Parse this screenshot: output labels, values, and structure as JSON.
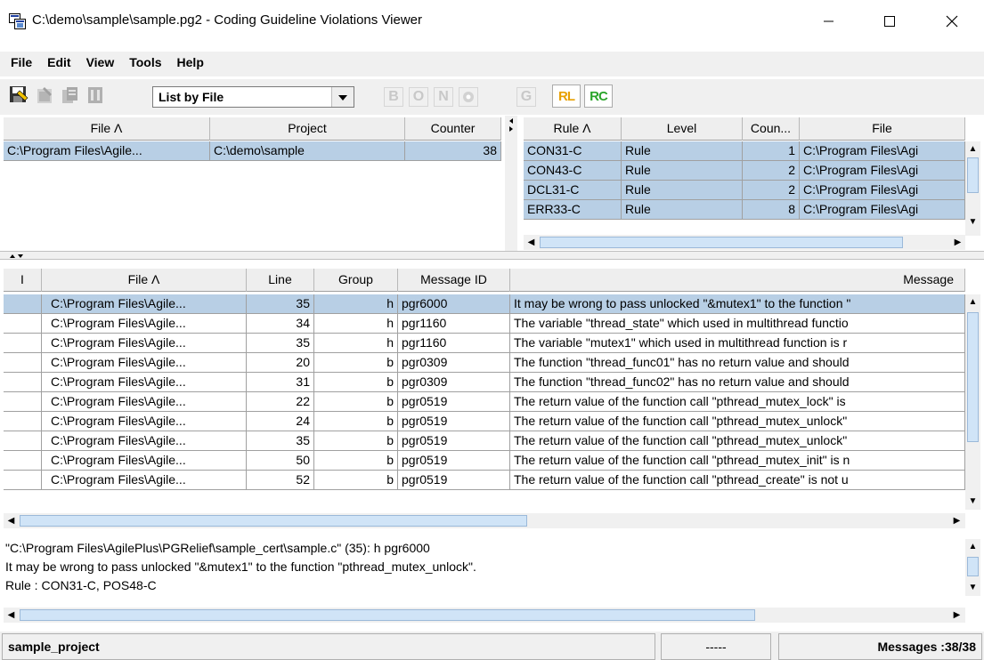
{
  "window": {
    "title": "C:\\demo\\sample\\sample.pg2 - Coding Guideline Violations Viewer",
    "minimize_icon": "minimize-icon",
    "maximize_icon": "maximize-icon",
    "close_icon": "close-icon"
  },
  "menu": [
    "File",
    "Edit",
    "View",
    "Tools",
    "Help"
  ],
  "toolbar": {
    "view_mode": "List by File",
    "letter_buttons": [
      "B",
      "O",
      "N",
      "G"
    ],
    "rl_label": "RL",
    "rc_label": "RC",
    "rl_color": "#e8a000",
    "rc_color": "#2aa52a"
  },
  "file_table": {
    "headers": [
      "File Λ",
      "Project",
      "Counter"
    ],
    "rows": [
      [
        "C:\\Program Files\\Agile...",
        "C:\\demo\\sample",
        "38"
      ]
    ]
  },
  "rule_table": {
    "headers": [
      "Rule Λ",
      "Level",
      "Coun...",
      "File"
    ],
    "rows": [
      [
        "CON31-C",
        "Rule",
        "1",
        "C:\\Program Files\\Agi"
      ],
      [
        "CON43-C",
        "Rule",
        "2",
        "C:\\Program Files\\Agi"
      ],
      [
        "DCL31-C",
        "Rule",
        "2",
        "C:\\Program Files\\Agi"
      ],
      [
        "ERR33-C",
        "Rule",
        "8",
        "C:\\Program Files\\Agi"
      ]
    ]
  },
  "message_table": {
    "headers": [
      "I",
      "File Λ",
      "Line",
      "Group",
      "Message ID",
      "Message"
    ],
    "rows": [
      [
        "",
        "C:\\Program Files\\Agile...",
        "35",
        "h",
        "pgr6000",
        "It may be wrong to pass unlocked \"&mutex1\" to the function \""
      ],
      [
        "",
        "C:\\Program Files\\Agile...",
        "34",
        "h",
        "pgr1160",
        "The variable \"thread_state\" which used in multithread functio"
      ],
      [
        "",
        "C:\\Program Files\\Agile...",
        "35",
        "h",
        "pgr1160",
        "The variable \"mutex1\" which used in multithread function is r"
      ],
      [
        "",
        "C:\\Program Files\\Agile...",
        "20",
        "b",
        "pgr0309",
        "The function \"thread_func01\" has no return value and should"
      ],
      [
        "",
        "C:\\Program Files\\Agile...",
        "31",
        "b",
        "pgr0309",
        "The function \"thread_func02\" has no return value and should"
      ],
      [
        "",
        "C:\\Program Files\\Agile...",
        "22",
        "b",
        "pgr0519",
        "The return value of the function call \"pthread_mutex_lock\" is"
      ],
      [
        "",
        "C:\\Program Files\\Agile...",
        "24",
        "b",
        "pgr0519",
        "The return value of the function call \"pthread_mutex_unlock\""
      ],
      [
        "",
        "C:\\Program Files\\Agile...",
        "35",
        "b",
        "pgr0519",
        "The return value of the function call \"pthread_mutex_unlock\""
      ],
      [
        "",
        "C:\\Program Files\\Agile...",
        "50",
        "b",
        "pgr0519",
        "The return value of the function call \"pthread_mutex_init\" is n"
      ],
      [
        "",
        "C:\\Program Files\\Agile...",
        "52",
        "b",
        "pgr0519",
        "The return value of the function call \"pthread_create\" is not u"
      ]
    ]
  },
  "detail": {
    "line1": "\"C:\\Program Files\\AgilePlus\\PGRelief\\sample_cert\\sample.c\" (35): h pgr6000",
    "line2": "It may be wrong to pass unlocked \"&mutex1\" to the function \"pthread_mutex_unlock\".",
    "line3": "Rule : CON31-C, POS48-C"
  },
  "status": {
    "project": "sample_project",
    "middle": "-----",
    "messages": "Messages :38/38"
  }
}
